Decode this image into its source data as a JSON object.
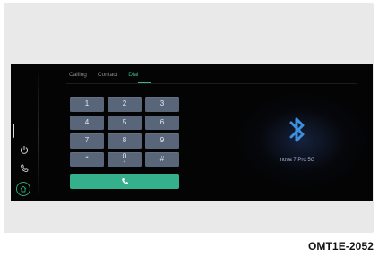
{
  "tabs": [
    {
      "label": "Calling",
      "active": false
    },
    {
      "label": "Contact",
      "active": false
    },
    {
      "label": "Dial",
      "active": true
    }
  ],
  "keypad": {
    "keys": [
      {
        "main": "1",
        "sub": ""
      },
      {
        "main": "2",
        "sub": ""
      },
      {
        "main": "3",
        "sub": ""
      },
      {
        "main": "4",
        "sub": ""
      },
      {
        "main": "5",
        "sub": ""
      },
      {
        "main": "6",
        "sub": ""
      },
      {
        "main": "7",
        "sub": ""
      },
      {
        "main": "8",
        "sub": ""
      },
      {
        "main": "9",
        "sub": ""
      },
      {
        "main": "*",
        "sub": ""
      },
      {
        "main": "0",
        "sub": "+"
      },
      {
        "main": "#",
        "sub": ""
      }
    ]
  },
  "call_button": {
    "icon": "phone-icon"
  },
  "side_rail": {
    "icons": [
      "power-icon",
      "phone-icon",
      "home-icon"
    ]
  },
  "bluetooth": {
    "icon": "bluetooth-icon",
    "device_name": "nova 7 Pro 5G"
  },
  "caption": "OMT1E-2052",
  "colors": {
    "accent": "#39b38c",
    "key_bg": "#596579",
    "screen_bg": "#040405",
    "bluetooth": "#3d8fe0"
  }
}
